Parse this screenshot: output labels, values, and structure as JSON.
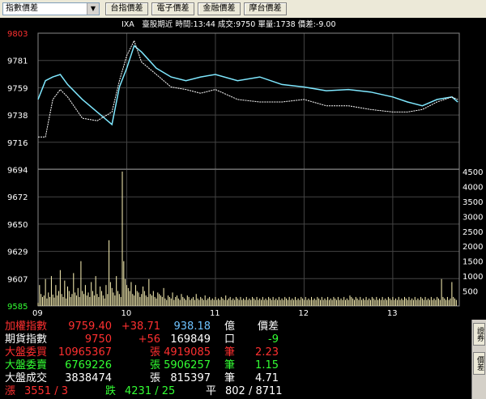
{
  "toolbar": {
    "select_value": "指數價差",
    "buttons": [
      "台指價差",
      "電子價差",
      "金融價差",
      "摩台價差"
    ]
  },
  "status_line": "IXA　臺股期近 時間:13:44 成交:9750 單量:1738 價差:-9.00",
  "axes": {
    "price_ticks": [
      "9803",
      "9781",
      "9759",
      "9738",
      "9716",
      "9694",
      "9672",
      "9650",
      "9629",
      "9607",
      "9585"
    ],
    "volume_ticks": [
      "4500",
      "4000",
      "3500",
      "3000",
      "2500",
      "2000",
      "1500",
      "1000",
      "500"
    ],
    "time_ticks": [
      "09",
      "10",
      "11",
      "12",
      "13"
    ]
  },
  "info_rows": [
    {
      "cells": [
        {
          "text": "加權指數",
          "color": "#ff3030"
        },
        {
          "text": "9759.40",
          "color": "#ff3030"
        },
        {
          "text": "+38.71",
          "color": "#ff3030"
        },
        {
          "text": "938.18",
          "color": "#6ec3ff"
        },
        {
          "text": "億",
          "color": "#ffffff"
        },
        {
          "text": "價差",
          "color": "#ffffff"
        }
      ]
    },
    {
      "cells": [
        {
          "text": "期貨指數",
          "color": "#ffffff"
        },
        {
          "text": "9750",
          "color": "#ff3030"
        },
        {
          "text": "+56",
          "color": "#ff3030"
        },
        {
          "text": "169849",
          "color": "#ffffff"
        },
        {
          "text": "口",
          "color": "#ffffff"
        },
        {
          "text": "-9",
          "color": "#33ff33"
        }
      ]
    },
    {
      "cells": [
        {
          "text": "大盤委買",
          "color": "#ff3030"
        },
        {
          "text": "10965367",
          "color": "#ff3030"
        },
        {
          "text": "張",
          "color": "#ff3030"
        },
        {
          "text": "4919085",
          "color": "#ff3030"
        },
        {
          "text": "筆",
          "color": "#ff3030"
        },
        {
          "text": "2.23",
          "color": "#ff3030"
        }
      ]
    },
    {
      "cells": [
        {
          "text": "大盤委賣",
          "color": "#33ff33"
        },
        {
          "text": "6769226",
          "color": "#33ff33"
        },
        {
          "text": "張",
          "color": "#33ff33"
        },
        {
          "text": "5906257",
          "color": "#33ff33"
        },
        {
          "text": "筆",
          "color": "#33ff33"
        },
        {
          "text": "1.15",
          "color": "#33ff33"
        }
      ]
    },
    {
      "cells": [
        {
          "text": "大盤成交",
          "color": "#ffffff"
        },
        {
          "text": "3838474",
          "color": "#ffffff"
        },
        {
          "text": "張",
          "color": "#ffffff"
        },
        {
          "text": "815397",
          "color": "#ffffff"
        },
        {
          "text": "筆",
          "color": "#ffffff"
        },
        {
          "text": "4.71",
          "color": "#ffffff"
        }
      ]
    },
    {
      "cells": [
        {
          "text": "漲",
          "color": "#ff3030"
        },
        {
          "text": "3551 / 3",
          "color": "#ff3030"
        },
        {
          "text": "跌",
          "color": "#33ff33"
        },
        {
          "text": "4231 / 25",
          "color": "#33ff33"
        },
        {
          "text": "平",
          "color": "#ffffff"
        },
        {
          "text": "802 / 8711",
          "color": "#ffffff"
        }
      ]
    }
  ],
  "side_tabs": [
    "證券",
    "價差"
  ],
  "colors": {
    "index_line": "#7fe8ff",
    "futures_line": "#ffffff",
    "volume_bars": "#fff6b8",
    "top_tick": "#ff3030",
    "bottom_tick": "#33ff33",
    "grid": "#444444"
  },
  "chart_data": {
    "type": "line",
    "title": "",
    "x_range": [
      "09:00",
      "13:45"
    ],
    "price_ylim": [
      9585,
      9803
    ],
    "volume_ylim": [
      0,
      4500
    ],
    "series": [
      {
        "name": "",
        "x": [
          "09:00",
          "09:05",
          "09:10",
          "09:15",
          "09:20",
          "09:30",
          "09:40",
          "09:50",
          "09:55",
          "10:00",
          "10:05",
          "10:10",
          "10:20",
          "10:30",
          "10:40",
          "10:50",
          "11:00",
          "11:15",
          "11:30",
          "11:45",
          "12:00",
          "12:15",
          "12:30",
          "12:45",
          "13:00",
          "13:10",
          "13:20",
          "13:30",
          "13:40",
          "13:44"
        ],
        "values": [
          9750,
          9765,
          9768,
          9770,
          9762,
          9750,
          9740,
          9730,
          9760,
          9775,
          9793,
          9788,
          9775,
          9768,
          9765,
          9768,
          9770,
          9765,
          9768,
          9762,
          9760,
          9757,
          9758,
          9756,
          9752,
          9748,
          9745,
          9750,
          9752,
          9748
        ]
      },
      {
        "name": "",
        "x": [
          "09:00",
          "09:05",
          "09:10",
          "09:15",
          "09:20",
          "09:30",
          "09:40",
          "09:50",
          "09:55",
          "10:00",
          "10:05",
          "10:10",
          "10:20",
          "10:30",
          "10:40",
          "10:50",
          "11:00",
          "11:15",
          "11:30",
          "11:45",
          "12:00",
          "12:15",
          "12:30",
          "12:45",
          "13:00",
          "13:10",
          "13:20",
          "13:30",
          "13:40",
          "13:44"
        ],
        "values": [
          9720,
          9720,
          9750,
          9758,
          9752,
          9735,
          9733,
          9740,
          9765,
          9785,
          9797,
          9780,
          9770,
          9760,
          9758,
          9755,
          9758,
          9750,
          9748,
          9748,
          9750,
          9745,
          9745,
          9742,
          9740,
          9740,
          9742,
          9748,
          9752,
          9750
        ]
      }
    ],
    "volume": {
      "x_start": "09:00",
      "interval_min": 1,
      "peak": 4500,
      "values": [
        100,
        700,
        400,
        300,
        350,
        900,
        250,
        450,
        300,
        1000,
        380,
        280,
        700,
        350,
        500,
        1200,
        400,
        300,
        850,
        250,
        650,
        500,
        300,
        400,
        1100,
        450,
        350,
        600,
        300,
        1500,
        500,
        400,
        700,
        350,
        450,
        300,
        800,
        500,
        350,
        1000,
        400,
        300,
        650,
        500,
        350,
        250,
        700,
        400,
        2200,
        800,
        600,
        450,
        350,
        1000,
        500,
        400,
        300,
        4500,
        1500,
        900,
        700,
        600,
        500,
        800,
        400,
        350,
        700,
        500,
        450,
        300,
        400,
        650,
        500,
        350,
        300,
        900,
        400,
        350,
        500,
        300,
        250,
        450,
        400,
        350,
        300,
        600,
        250,
        200,
        350,
        300,
        250,
        450,
        200,
        300,
        350,
        250,
        200,
        400,
        300,
        250,
        200,
        350,
        300,
        200,
        250,
        300,
        200,
        400,
        250,
        200,
        300,
        250,
        200,
        350,
        200,
        250,
        300,
        200,
        250,
        200,
        300,
        200,
        250,
        200,
        300,
        250,
        200,
        350,
        200,
        250,
        300,
        200,
        250,
        200,
        300,
        250,
        200,
        300,
        200,
        250,
        200,
        300,
        200,
        250,
        200,
        300,
        250,
        200,
        300,
        200,
        250,
        200,
        300,
        200,
        250,
        200,
        300,
        250,
        200,
        300,
        200,
        250,
        200,
        300,
        200,
        250,
        200,
        300,
        250,
        200,
        300,
        200,
        250,
        200,
        300,
        200,
        250,
        200,
        300,
        250,
        200,
        300,
        200,
        250,
        200,
        300,
        200,
        250,
        200,
        300,
        250,
        200,
        300,
        200,
        250,
        200,
        300,
        200,
        250,
        200,
        300,
        250,
        200,
        300,
        200,
        250,
        200,
        300,
        200,
        250,
        200,
        350,
        300,
        250,
        200,
        300,
        250,
        200,
        300,
        200,
        250,
        200,
        300,
        200,
        250,
        200,
        300,
        250,
        200,
        300,
        200,
        250,
        200,
        300,
        200,
        250,
        200,
        300,
        250,
        200,
        300,
        200,
        250,
        200,
        300,
        200,
        250,
        200,
        300,
        250,
        200,
        300,
        200,
        250,
        200,
        300,
        200,
        250,
        200,
        300,
        250,
        200,
        300,
        200,
        250,
        200,
        300,
        200,
        250,
        200,
        300,
        250,
        200,
        900,
        300,
        250,
        200,
        300,
        200,
        250,
        800,
        300,
        250,
        200,
        700,
        200,
        250,
        200,
        300,
        250,
        400,
        300,
        200,
        1800
      ]
    }
  }
}
